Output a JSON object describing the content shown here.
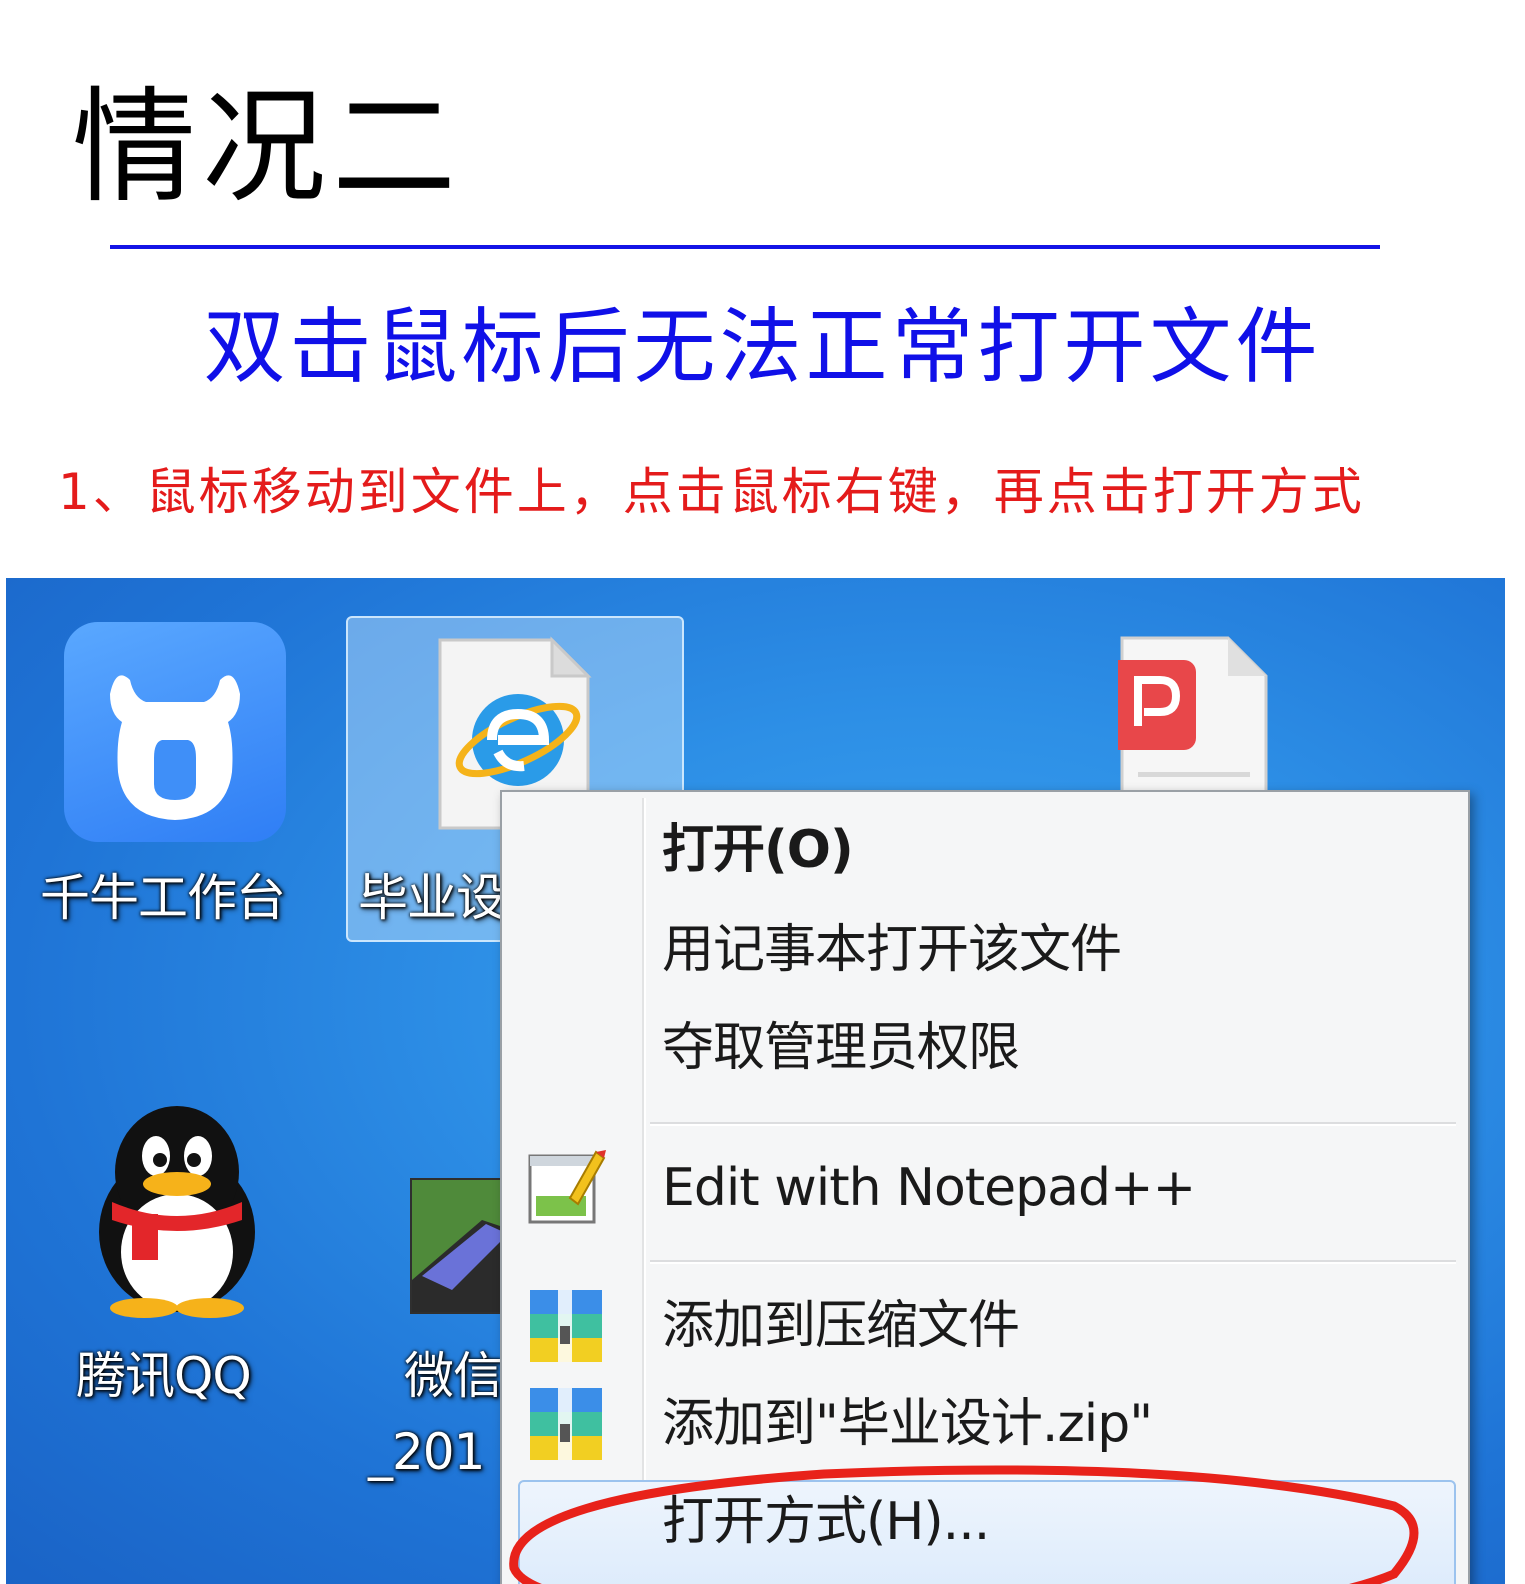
{
  "heading": "情况二",
  "subtitle": "双击鼠标后无法正常打开文件",
  "step": "1、鼠标移动到文件上，点击鼠标右键，再点击打开方式",
  "desktop": {
    "icons": [
      {
        "label": "千牛工作台",
        "icon": "qianniu-icon"
      },
      {
        "label": "毕业设",
        "icon": "ie-html-file-icon"
      },
      {
        "label": "腾讯QQ",
        "icon": "qq-penguin-icon"
      },
      {
        "label_line1": "微信",
        "label_line2": "_201",
        "icon": "wechat-video-icon"
      },
      {
        "label": "",
        "icon": "pdf-file-icon"
      }
    ]
  },
  "context_menu": {
    "items": [
      {
        "label": "打开(O)",
        "bold": true
      },
      {
        "label": "用记事本打开该文件"
      },
      {
        "label": "夺取管理员权限"
      },
      {
        "label": "Edit with Notepad++",
        "icon": "notepad-plus-plus-icon"
      },
      {
        "label": "添加到压缩文件",
        "icon": "archive-zip-icon"
      },
      {
        "label": "添加到\"毕业设计.zip\"",
        "icon": "archive-zip-icon"
      },
      {
        "label": "打开方式(H)...",
        "highlighted": true
      }
    ]
  },
  "colors": {
    "heading": "#000000",
    "subtitle": "#1010e8",
    "step": "#e41b1b",
    "annotation": "#e8221a"
  }
}
